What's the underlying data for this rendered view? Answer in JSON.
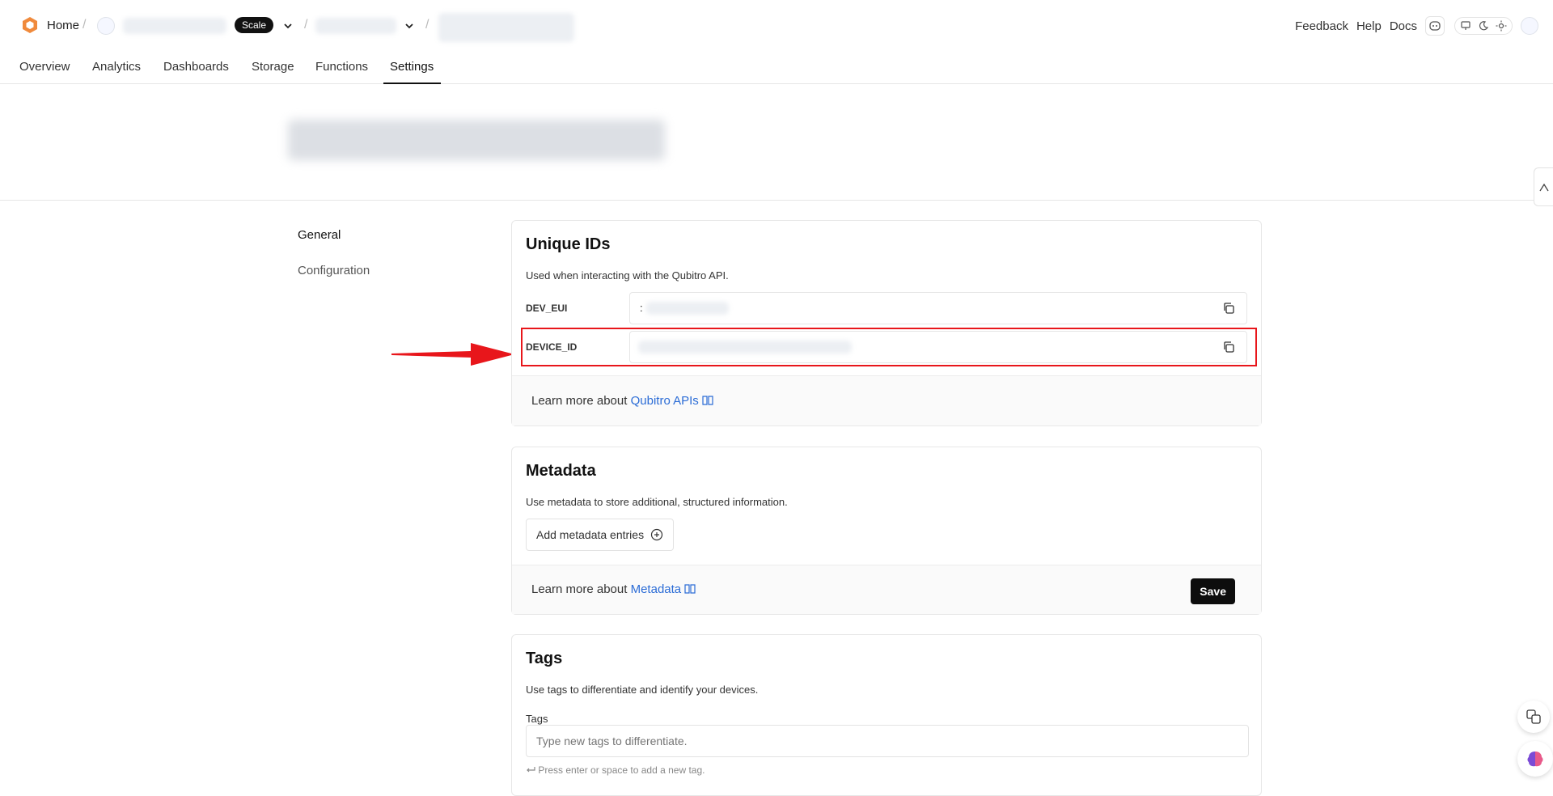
{
  "header": {
    "home_label": "Home",
    "plan_badge": "Scale",
    "separators": [
      "/",
      "/",
      "/"
    ],
    "right_links": [
      "Feedback",
      "Help",
      "Docs"
    ],
    "icons": [
      "discord-icon",
      "monitor-icon",
      "moon-icon",
      "sun-icon",
      "globe-icon"
    ]
  },
  "tabs": [
    {
      "label": "Overview"
    },
    {
      "label": "Analytics"
    },
    {
      "label": "Dashboards"
    },
    {
      "label": "Storage"
    },
    {
      "label": "Functions"
    },
    {
      "label": "Settings",
      "active": true
    }
  ],
  "sidebar": {
    "items": [
      {
        "label": "General",
        "active": true
      },
      {
        "label": "Configuration"
      }
    ]
  },
  "unique_ids": {
    "title": "Unique IDs",
    "description": "Used when interacting with the Qubitro API.",
    "rows": [
      {
        "label": "DEV_EUI",
        "value_prefix": ":"
      },
      {
        "label": "DEVICE_ID",
        "value_prefix": ""
      }
    ],
    "footer_text": "Learn more about",
    "footer_link": "Qubitro APIs"
  },
  "metadata": {
    "title": "Metadata",
    "description": "Use metadata to store additional, structured information.",
    "add_button": "Add metadata entries",
    "footer_text": "Learn more about",
    "footer_link": "Metadata",
    "save_label": "Save"
  },
  "tags": {
    "title": "Tags",
    "description": "Use tags to differentiate and identify your devices.",
    "field_label": "Tags",
    "placeholder": "Type new tags to differentiate.",
    "hint": "Press enter or space to add a new tag."
  },
  "colors": {
    "accent_link": "#2b6cd6",
    "highlight": "#e8161b",
    "brand_orange": "#f08a3c"
  }
}
